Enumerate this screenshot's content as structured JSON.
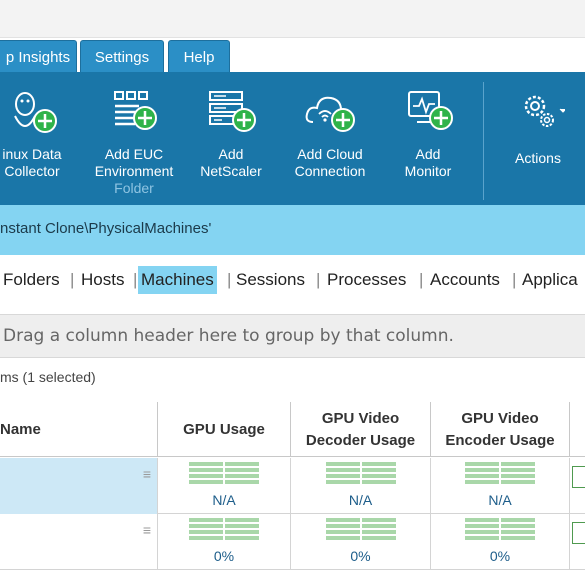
{
  "tabs": [
    {
      "label": "p Insights"
    },
    {
      "label": "Settings"
    },
    {
      "label": "Help"
    }
  ],
  "ribbon": {
    "buttons": [
      {
        "label": "inux Data\nCollector",
        "icon": "linux-collector-add-icon"
      },
      {
        "label": "Add EUC\nEnvironment",
        "sub": "Folder",
        "icon": "euc-environment-add-icon"
      },
      {
        "label": "Add\nNetScaler",
        "icon": "netscaler-add-icon"
      },
      {
        "label": "Add Cloud\nConnection",
        "icon": "cloud-connection-add-icon"
      },
      {
        "label": "Add\nMonitor",
        "icon": "monitor-add-icon"
      },
      {
        "label": "Actions",
        "icon": "gears-icon"
      }
    ]
  },
  "path": "nstant Clone\\PhysicalMachines'",
  "subnav": {
    "items": [
      "Folders",
      "Hosts",
      "Machines",
      "Sessions",
      "Processes",
      "Accounts",
      "Applica"
    ],
    "active": "Machines"
  },
  "group_panel_text": "Drag a column header here to group by that column.",
  "count_text": "ms (1 selected)",
  "grid": {
    "columns": [
      {
        "label": "Name"
      },
      {
        "label": "GPU Usage"
      },
      {
        "label": "GPU Video\nDecoder Usage"
      },
      {
        "label": "GPU Video\nEncoder Usage"
      }
    ],
    "rows": [
      {
        "selected": true,
        "gpu_usage": "N/A",
        "decoder": "N/A",
        "encoder": "N/A"
      },
      {
        "selected": false,
        "gpu_usage": "0%",
        "decoder": "0%",
        "encoder": "0%"
      }
    ]
  },
  "colors": {
    "tab_bg": "#2b8fc6",
    "ribbon_bg": "#1a76a8",
    "path_bg": "#84d4f2",
    "selected_row": "#cde8f6",
    "add_badge": "#2fb34a"
  }
}
